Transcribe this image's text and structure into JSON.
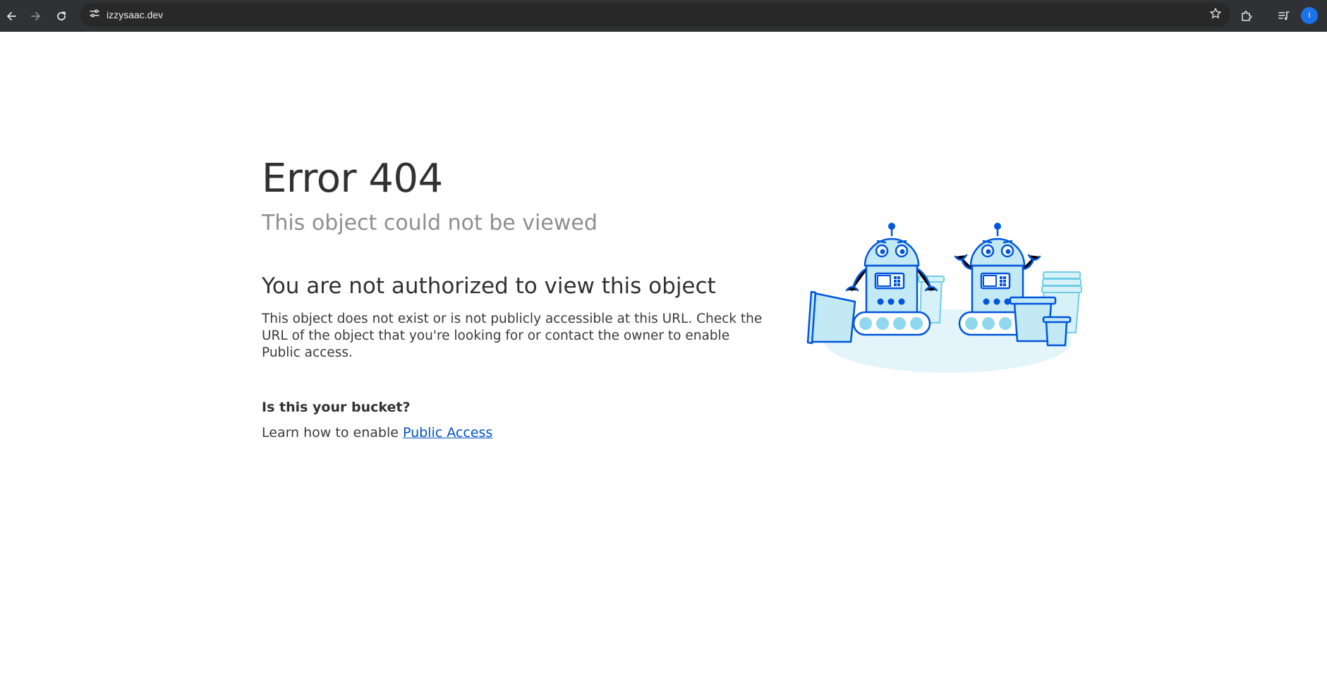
{
  "browser": {
    "url": "izzysaac.dev",
    "profile_initial": "I"
  },
  "page": {
    "title": "Error 404",
    "subtitle": "This object could not be viewed",
    "heading": "You are not authorized to view this object",
    "description": "This object does not exist or is not publicly accessible at this URL. Check the URL of the object that you're looking for or contact the owner to enable Public access.",
    "bucket_question": "Is this your bucket?",
    "learn_prefix": "Learn how to enable",
    "learn_link": "Public Access"
  },
  "icons": {
    "back": "arrow-left-icon",
    "forward": "arrow-right-icon",
    "reload": "reload-icon",
    "site_info": "tune-icon",
    "bookmark": "star-icon",
    "extensions": "puzzle-icon",
    "media": "queue-music-icon"
  },
  "colors": {
    "link": "#0051c3",
    "robot_stroke": "#0055dc",
    "robot_fill": "#c3e9f5",
    "floor": "#e3f4fa"
  }
}
